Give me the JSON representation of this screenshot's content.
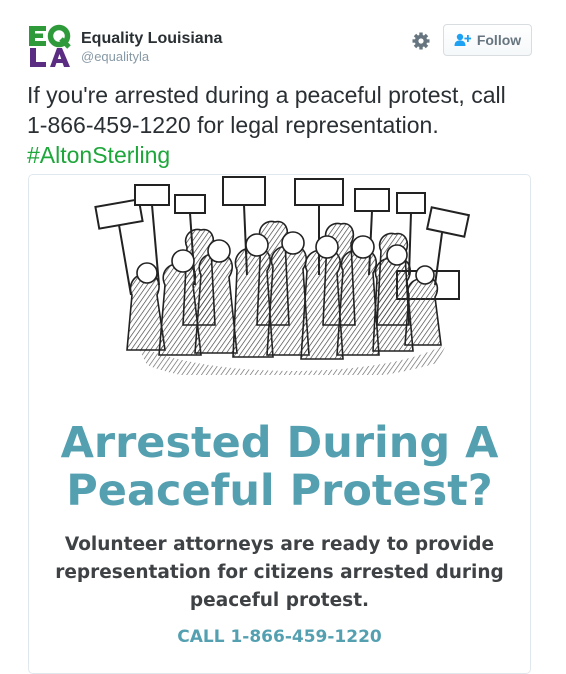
{
  "account": {
    "display_name": "Equality Louisiana",
    "handle": "@equalityla",
    "avatar_letters": [
      "EQ",
      "LA"
    ]
  },
  "actions": {
    "settings_icon": "gear-icon",
    "follow_label": "Follow",
    "follow_icon": "add-person-icon"
  },
  "tweet": {
    "text_line1": "If you're arrested during a peaceful protest, call",
    "text_line2": "1-866-459-1220 for legal representation.",
    "hashtag": "#AltonSterling"
  },
  "media": {
    "headline_line1": "Arrested During A",
    "headline_line2": "Peaceful Protest?",
    "body_line1": "Volunteer attorneys are ready to provide",
    "body_line2": "representation for citizens arrested during",
    "body_line3": "peaceful protest.",
    "call_text": "CALL 1-866-459-1220"
  },
  "colors": {
    "hashtag": "#1da63a",
    "headline": "#54a0b1",
    "name": "#292f33",
    "muted": "#8899a6",
    "avatar_green": "#2e9a3a",
    "avatar_purple": "#5a2d82"
  }
}
